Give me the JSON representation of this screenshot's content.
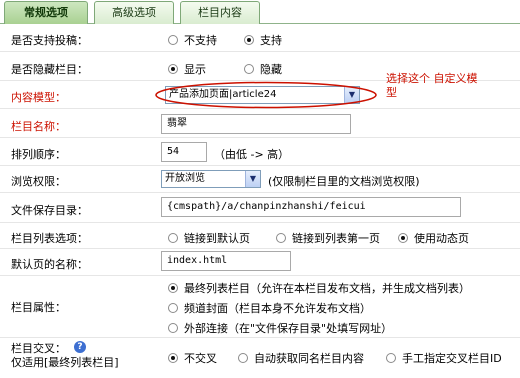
{
  "tabs": [
    {
      "label": "常规选项",
      "active": true
    },
    {
      "label": "高级选项",
      "active": false
    },
    {
      "label": "栏目内容",
      "active": false
    }
  ],
  "form": {
    "allow_submit": {
      "label": "是否支持投稿：",
      "options": [
        "不支持",
        "支持"
      ],
      "selected": "支持"
    },
    "hidden": {
      "label": "是否隐藏栏目：",
      "options": [
        "显示",
        "隐藏"
      ],
      "selected": "显示"
    },
    "content_model": {
      "label": "内容模型：",
      "value": "产品添加页面|article24"
    },
    "name": {
      "label": "栏目名称：",
      "value": "翡翠"
    },
    "order": {
      "label": "排列顺序：",
      "value": "54",
      "note": "（由低 -> 高）"
    },
    "browse": {
      "label": "浏览权限：",
      "value": "开放浏览",
      "note": "(仅限制栏目里的文档浏览权限)"
    },
    "save_dir": {
      "label": "文件保存目录：",
      "value": "{cmspath}/a/chanpinzhanshi/feicui"
    },
    "list_option": {
      "label": "栏目列表选项：",
      "options": [
        "链接到默认页",
        "链接到列表第一页",
        "使用动态页"
      ],
      "selected": "使用动态页"
    },
    "default_page": {
      "label": "默认页的名称：",
      "value": "index.html"
    },
    "attribute": {
      "label": "栏目属性：",
      "options": [
        "最终列表栏目（允许在本栏目发布文档，并生成文档列表）",
        "频道封面（栏目本身不允许发布文档）",
        "外部连接（在\"文件保存目录\"处填写网址）"
      ],
      "selected": "最终列表栏目（允许在本栏目发布文档，并生成文档列表）"
    },
    "cross": {
      "label_line1": "栏目交叉：",
      "label_line2": "仅适用[最终列表栏目]",
      "help_icon": "?",
      "options": [
        "不交叉",
        "自动获取同名栏目内容",
        "手工指定交叉栏目ID"
      ],
      "selected": "不交叉"
    }
  },
  "annotation": {
    "line1": "选择这个 自定义模",
    "line2": "型"
  },
  "colors": {
    "annotation_red": "#cc1100",
    "tab_green": "#a9d192",
    "select_blue": "#7f9db9"
  }
}
